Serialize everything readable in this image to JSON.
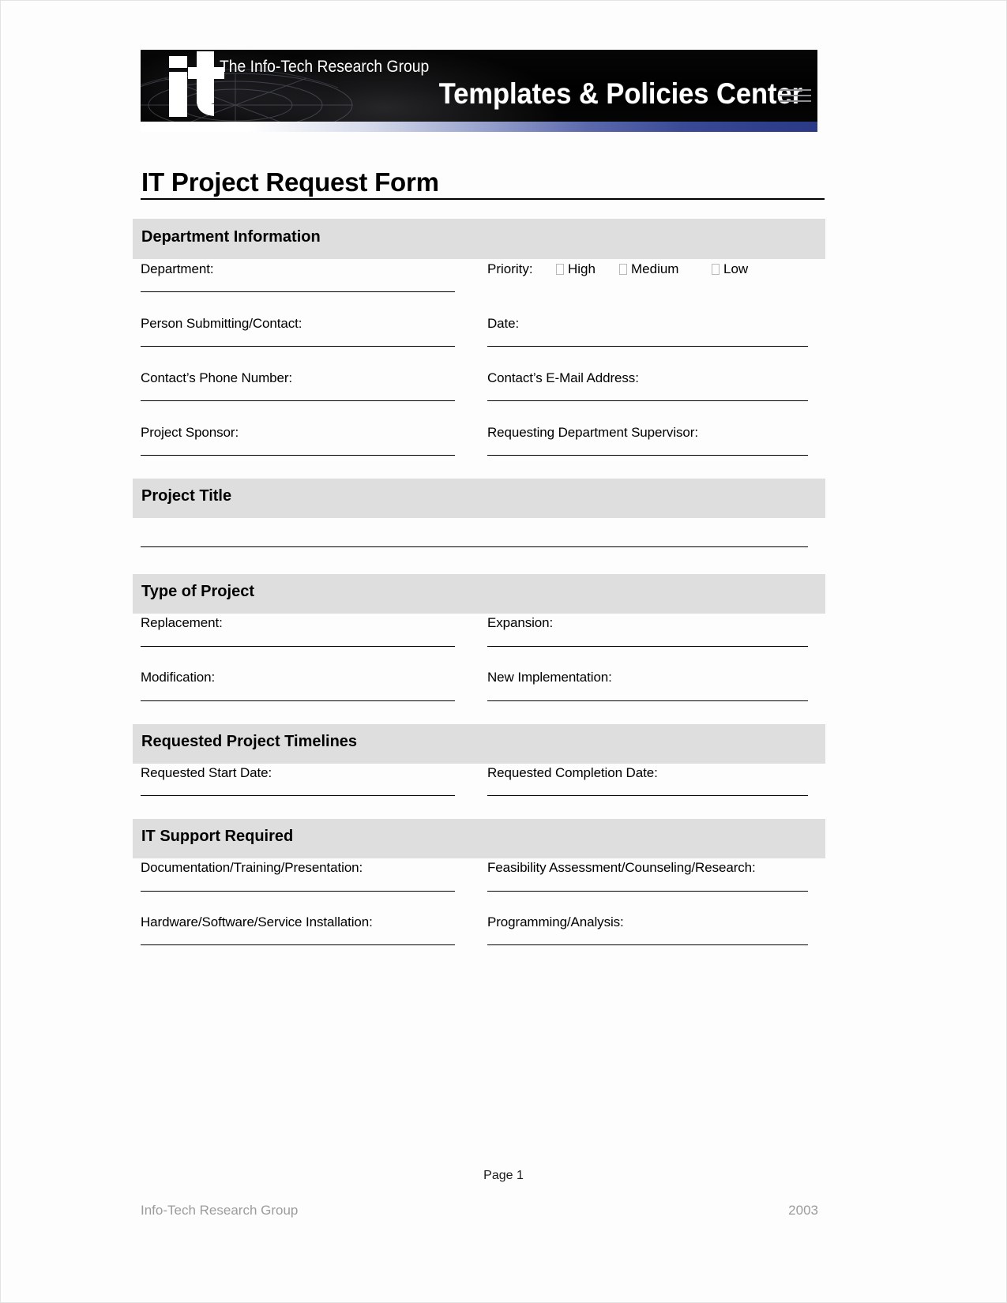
{
  "banner": {
    "logo_text": "it",
    "tagline": "The Info-Tech Research Group",
    "title": "Templates & Policies Center"
  },
  "document": {
    "title": "IT Project Request Form"
  },
  "sections": [
    {
      "id": "department-information",
      "heading": "Department Information",
      "priority": {
        "label": "Priority:",
        "options": [
          "High",
          "Medium",
          "Low"
        ]
      },
      "fields": [
        {
          "label": "Department:",
          "column": "left"
        },
        {
          "label": "Person Submitting/Contact:",
          "column": "left"
        },
        {
          "label": "Date:",
          "column": "right"
        },
        {
          "label": "Contact’s Phone Number:",
          "column": "left"
        },
        {
          "label": "Contact’s E-Mail Address:",
          "column": "right"
        },
        {
          "label": "Project Sponsor:",
          "column": "left"
        },
        {
          "label": "Requesting Department Supervisor:",
          "column": "right"
        }
      ]
    },
    {
      "id": "project-title",
      "heading": "Project Title",
      "fields": []
    },
    {
      "id": "type-of-project",
      "heading": "Type of Project",
      "fields": [
        {
          "label": "Replacement:",
          "column": "left"
        },
        {
          "label": "Expansion:",
          "column": "right"
        },
        {
          "label": "Modification:",
          "column": "left"
        },
        {
          "label": "New Implementation:",
          "column": "right"
        }
      ]
    },
    {
      "id": "requested-project-timelines",
      "heading": "Requested Project Timelines",
      "fields": [
        {
          "label": "Requested Start Date:",
          "column": "left"
        },
        {
          "label": "Requested Completion Date:",
          "column": "right"
        }
      ]
    },
    {
      "id": "it-support-required",
      "heading": "IT Support Required",
      "fields": [
        {
          "label": "Documentation/Training/Presentation:",
          "column": "left"
        },
        {
          "label": "Feasibility Assessment/Counseling/Research:",
          "column": "right"
        },
        {
          "label": "Hardware/Software/Service Installation:",
          "column": "left"
        },
        {
          "label": "Programming/Analysis:",
          "column": "right"
        }
      ]
    }
  ],
  "footer": {
    "page": "Page 1",
    "company": "Info-Tech Research Group",
    "year": "2003"
  },
  "colors": {
    "section_band": "#dedede",
    "banner_background": "#000000",
    "gradient_bar_end": "#2b3a86",
    "footer_text": "#9c9c9c"
  }
}
